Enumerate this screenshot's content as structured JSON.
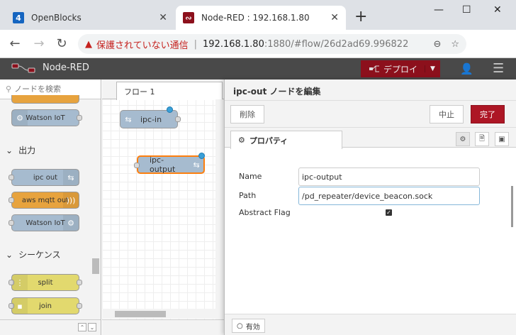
{
  "browser": {
    "tabs": [
      {
        "title": "OpenBlocks",
        "favicon": "openblocks-icon",
        "favicon_color": "#1565c0"
      },
      {
        "title": "Node-RED : 192.168.1.80",
        "favicon": "node-red-icon",
        "favicon_color": "#8c101c"
      }
    ],
    "address": {
      "security_label": "保護されていない通信",
      "host": "192.168.1.80",
      "path": ":1880/#flow/26d2ad69.996822"
    }
  },
  "header": {
    "app_name": "Node-RED",
    "deploy_label": "デプロイ"
  },
  "palette": {
    "search_placeholder": "ノードを検索",
    "categories": [
      {
        "label": "出力"
      },
      {
        "label": "シーケンス"
      }
    ],
    "nodes": [
      {
        "label": "Watson IoT",
        "color": "#a6bbcf"
      },
      {
        "label": "ipc out",
        "color": "#a6bbcf"
      },
      {
        "label": "aws mqtt out",
        "color": "#e7a33e"
      },
      {
        "label": "Watson IoT",
        "color": "#a6bbcf"
      },
      {
        "label": "split",
        "color": "#e2d96e"
      },
      {
        "label": "join",
        "color": "#e2d96e"
      }
    ]
  },
  "workspace": {
    "tab_label": "フロー 1",
    "nodes": [
      {
        "label": "ipc-in"
      },
      {
        "label": "ipc-output"
      }
    ]
  },
  "editor": {
    "title": "ipc-out ノードを編集",
    "delete_label": "削除",
    "cancel_label": "中止",
    "done_label": "完了",
    "tab_label": "プロパティ",
    "fields": {
      "name_label": "Name",
      "name_value": "ipc-output",
      "path_label": "Path",
      "path_value": "/pd_repeater/device_beacon.sock",
      "abstract_label": "Abstract Flag",
      "abstract_checked": true
    },
    "enabled_label": "有効"
  }
}
